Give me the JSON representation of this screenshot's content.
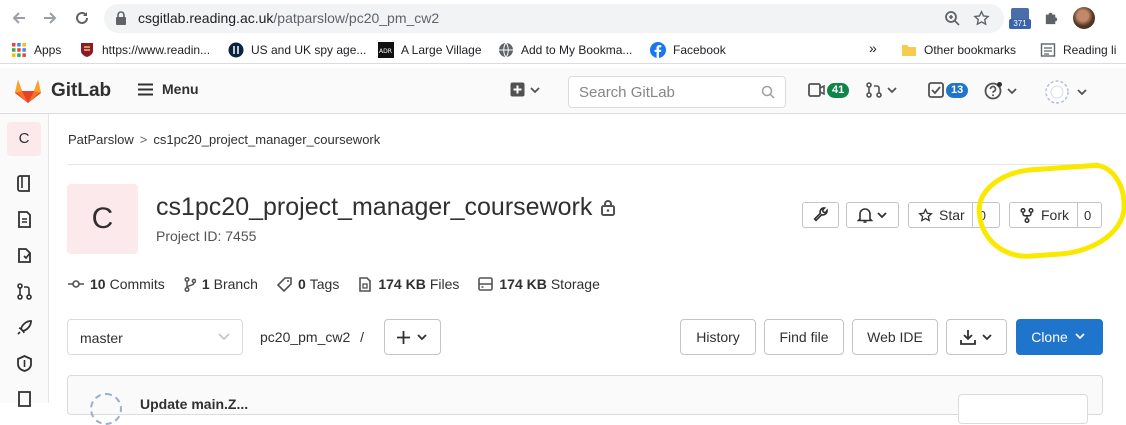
{
  "browser": {
    "url_host": "csgitlab.reading.ac.uk",
    "url_path": "/patparslow/pc20_pm_cw2",
    "extension_badge": "371",
    "bookmarks": [
      {
        "label": "Apps",
        "icon": "apps-grid-icon"
      },
      {
        "label": "https://www.readin...",
        "icon": "reading-crest-icon"
      },
      {
        "label": "US and UK spy age...",
        "icon": "circle-logo-icon"
      },
      {
        "label": "A Large Village",
        "icon": "arr-logo-icon"
      },
      {
        "label": "Add to My Bookma...",
        "icon": "globe-icon"
      },
      {
        "label": "Facebook",
        "icon": "facebook-icon"
      }
    ],
    "overflow": "»",
    "other_bookmarks": "Other bookmarks",
    "reading_list": "Reading li"
  },
  "gitlab": {
    "brand": "GitLab",
    "menu": "Menu",
    "search_placeholder": "Search GitLab",
    "issues_count": "41",
    "todos_count": "13",
    "accent": "#1f75cb",
    "brand_orange": "#e24329"
  },
  "sidebar": {
    "avatar_letter": "C"
  },
  "breadcrumb": {
    "owner": "PatParslow",
    "sep": ">",
    "project": "cs1pc20_project_manager_coursework"
  },
  "project": {
    "avatar_letter": "C",
    "title": "cs1pc20_project_manager_coursework",
    "id_text": "Project ID: 7455",
    "star_label": "Star",
    "star_count": "0",
    "fork_label": "Fork",
    "fork_count": "0"
  },
  "stats": {
    "commits_num": "10",
    "commits_label": "Commits",
    "branch_num": "1",
    "branch_label": "Branch",
    "tags_num": "0",
    "tags_label": "Tags",
    "files_num": "174 KB",
    "files_label": "Files",
    "storage_num": "174 KB",
    "storage_label": "Storage"
  },
  "repo": {
    "branch": "master",
    "path": "pc20_pm_cw2",
    "path_sep": "/",
    "history": "History",
    "find_file": "Find file",
    "web_ide": "Web IDE",
    "clone": "Clone"
  },
  "commit": {
    "message": "Update main.Z..."
  }
}
